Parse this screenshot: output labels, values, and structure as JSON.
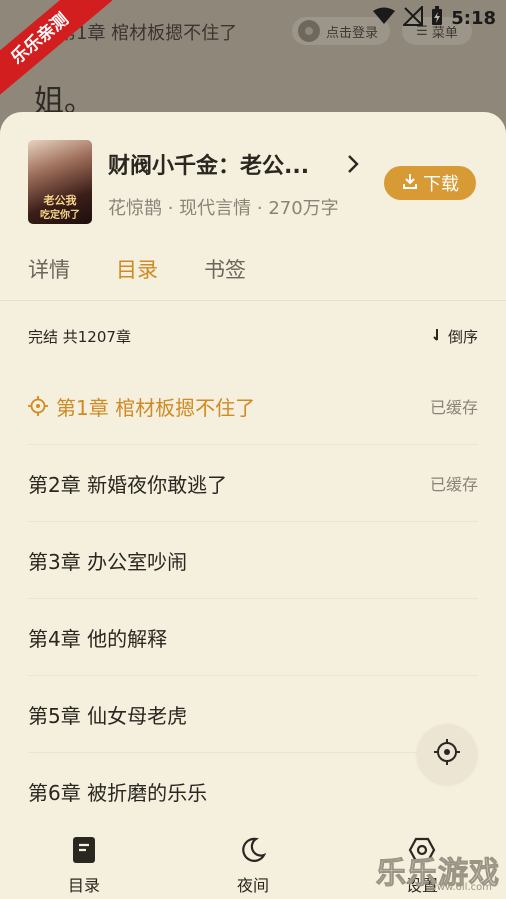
{
  "status_bar": {
    "time": "5:18"
  },
  "ribbon": "乐乐亲测",
  "reader": {
    "chapter_title": "第1章 棺材板摁不住了",
    "login_label": "点击登录",
    "menu_label": "菜单",
    "visible_text": "姐。"
  },
  "book": {
    "title": "财阀小千金：老公...",
    "meta": "花惊鹊 · 现代言情 · 270万字",
    "cover_title_line1": "老公我",
    "cover_title_line2": "吃定你了",
    "download_label": "下载"
  },
  "tabs": [
    {
      "label": "详情",
      "active": false
    },
    {
      "label": "目录",
      "active": true
    },
    {
      "label": "书签",
      "active": false
    }
  ],
  "catalog": {
    "summary": "完结 共1207章",
    "sort_label": "倒序"
  },
  "chapters": [
    {
      "title": "第1章 棺材板摁不住了",
      "status": "已缓存",
      "current": true
    },
    {
      "title": "第2章 新婚夜你敢逃了",
      "status": "已缓存",
      "current": false
    },
    {
      "title": "第3章 办公室吵闹",
      "status": "",
      "current": false
    },
    {
      "title": "第4章 他的解释",
      "status": "",
      "current": false
    },
    {
      "title": "第5章 仙女母老虎",
      "status": "",
      "current": false
    },
    {
      "title": "第6章 被折磨的乐乐",
      "status": "",
      "current": false
    }
  ],
  "bottom_nav": [
    {
      "label": "目录",
      "icon": "book-icon"
    },
    {
      "label": "夜间",
      "icon": "moon-icon"
    },
    {
      "label": "设置",
      "icon": "settings-icon"
    }
  ],
  "watermark": {
    "brand": "乐乐游戏",
    "url": "www.6ll.com"
  },
  "colors": {
    "accent": "#cf8a21",
    "download": "#d79a34",
    "sheet": "#f5efde",
    "ribbon": "#d21e1e"
  }
}
